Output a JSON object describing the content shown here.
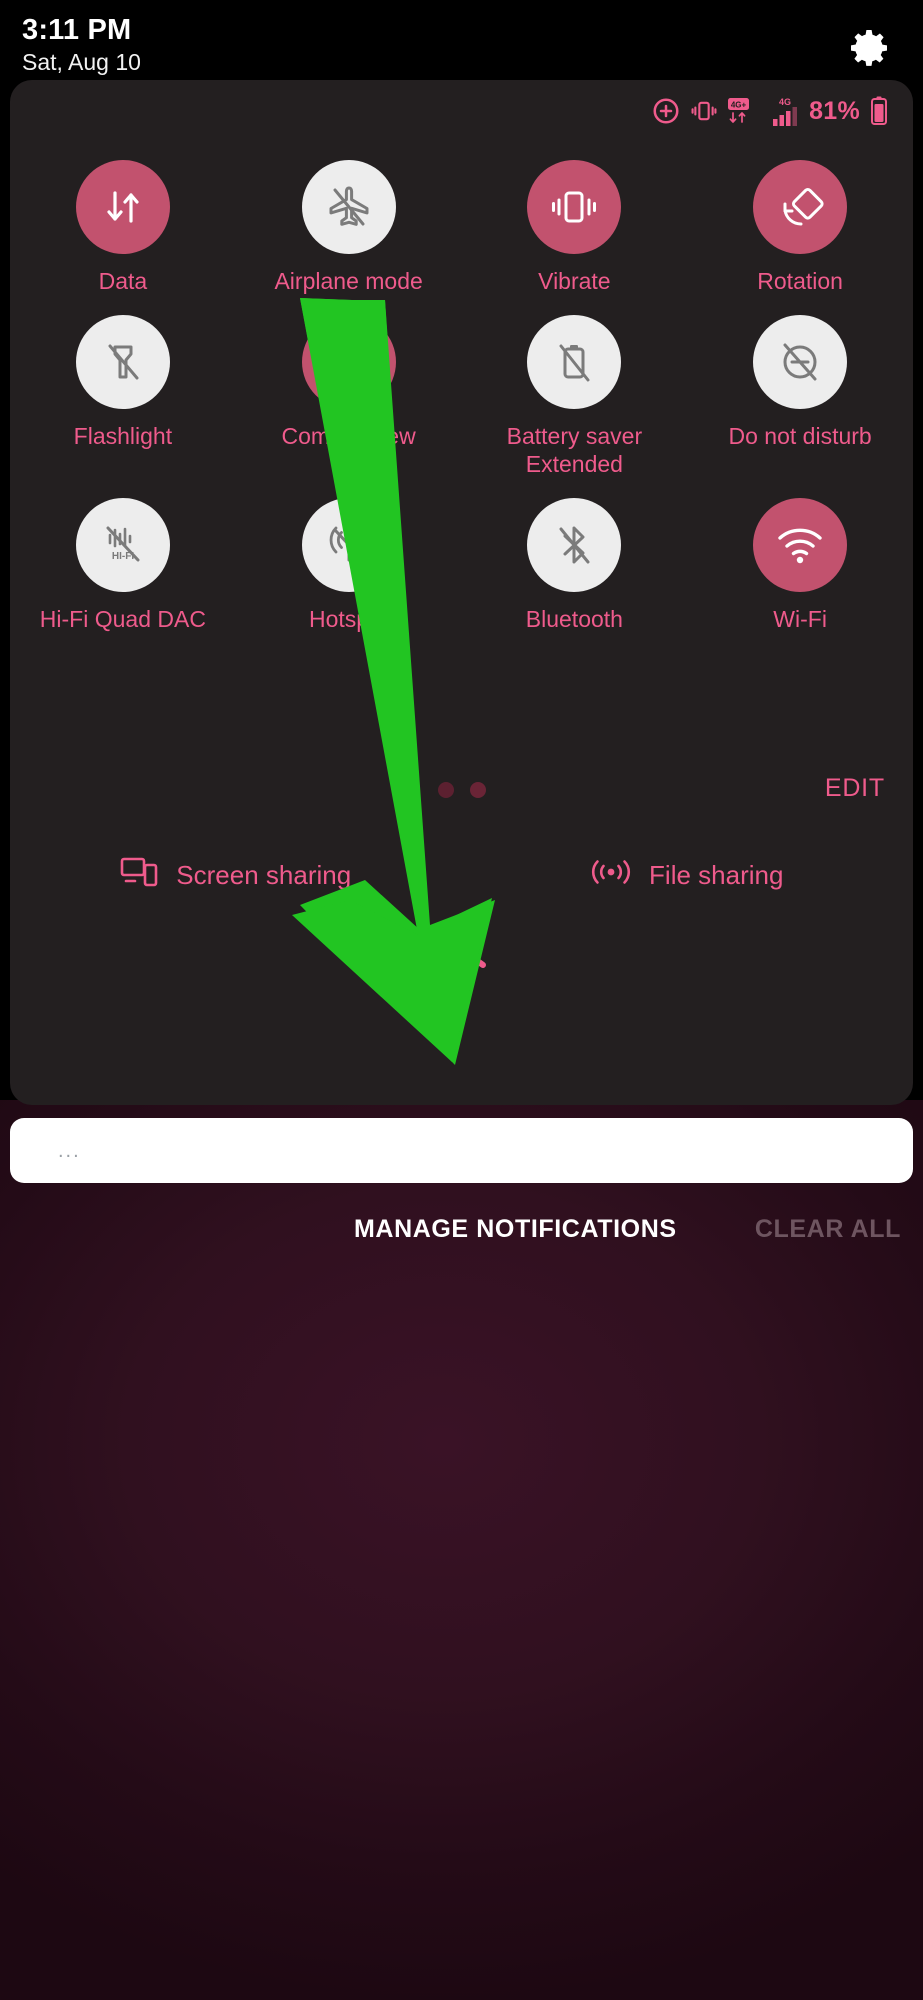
{
  "statusbar": {
    "time": "3:11 PM",
    "date": "Sat, Aug 10",
    "settings_icon": "gear-icon"
  },
  "panel_status": {
    "icons": [
      "dnd-plus-icon",
      "vibrate-icon",
      "volte-4g-data-icon",
      "signal-bars-icon"
    ],
    "network_label_1": "4G+",
    "network_label_2": "4G",
    "battery_percent": "81%",
    "battery_icon": "battery-icon"
  },
  "tiles": [
    {
      "label": "Data",
      "icon": "data-transfer-icon",
      "state": "on"
    },
    {
      "label": "Airplane mode",
      "icon": "airplane-off-icon",
      "state": "off"
    },
    {
      "label": "Vibrate",
      "icon": "vibrate-icon",
      "state": "on"
    },
    {
      "label": "Rotation",
      "icon": "rotation-icon",
      "state": "on"
    },
    {
      "label": "Flashlight",
      "icon": "flashlight-off-icon",
      "state": "off"
    },
    {
      "label": "Comfort view",
      "icon": "comfort-view-icon",
      "state": "on"
    },
    {
      "label": "Battery saver Extended",
      "icon": "battery-saver-off-icon",
      "state": "off"
    },
    {
      "label": "Do not disturb",
      "icon": "do-not-disturb-off-icon",
      "state": "off"
    },
    {
      "label": "Hi-Fi Quad DAC",
      "icon": "hifi-quad-dac-off-icon",
      "state": "off"
    },
    {
      "label": "Hotspot",
      "icon": "hotspot-off-icon",
      "state": "off"
    },
    {
      "label": "Bluetooth",
      "icon": "bluetooth-off-icon",
      "state": "off"
    },
    {
      "label": "Wi-Fi",
      "icon": "wifi-icon",
      "state": "on"
    }
  ],
  "controls": {
    "edit_label": "EDIT",
    "page_dots": 2,
    "active_dot_index": 1,
    "collapse_icon": "chevron-up-icon"
  },
  "sharing": [
    {
      "label": "Screen sharing",
      "icon": "screen-share-icon"
    },
    {
      "label": "File sharing",
      "icon": "file-share-icon"
    }
  ],
  "notification": {
    "placeholder": "..."
  },
  "footer": {
    "manage_label": "MANAGE NOTIFICATIONS",
    "clear_label": "CLEAR ALL"
  },
  "annotation": {
    "shape": "down-arrow",
    "color": "#22c522"
  },
  "colors": {
    "accent_pink": "#ef5b8c",
    "tile_on": "#c2526e",
    "tile_off": "#ededed",
    "panel_bg": "#231f20"
  }
}
